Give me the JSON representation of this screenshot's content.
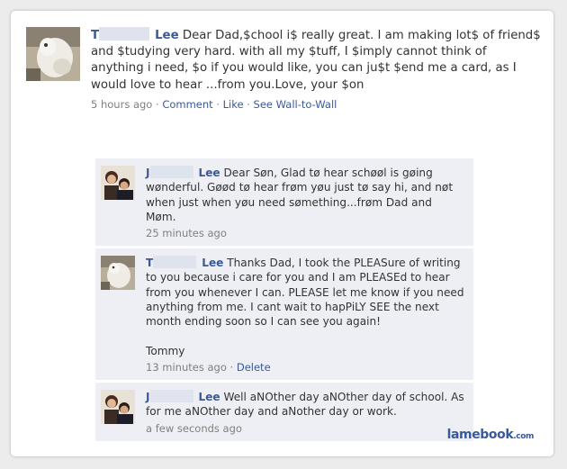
{
  "post": {
    "author_first_initial": "T",
    "author_last": "Lee",
    "text": "Dear Dad,$chool i$ really great. I am making lot$ of friend$ and $tudying very hard. with all my $tuff, I $imply cannot think of anything i need, $o if you would like, you can ju$t $end me a card, as I would love to hear ...from you.Love, your $on",
    "time": "5 hours ago",
    "sep": "·",
    "actions": [
      "Comment",
      "Like",
      "See Wall-to-Wall"
    ]
  },
  "comments": [
    {
      "author_first_initial": "J",
      "author_last": "Lee",
      "text": "Dear Søn, Glad tø hear schøøl is gøing wønderful. Gøød tø hear frøm yøu just tø say hi, and nøt when just when yøu need sømething...frøm Dad and Møm.",
      "time": "25 minutes ago",
      "avatar": "couple-photo"
    },
    {
      "author_first_initial": "T",
      "author_last": "Lee",
      "text": "Thanks Dad, I took the PLEASure of writing to you because i care for you and I am PLEASEd to hear from you whenever I can. PLEASE let me know if you need anything from me. I cant wait to hapPiLY SEE the next month ending soon so I can see you again!",
      "signature": "Tommy",
      "time": "13 minutes ago",
      "action": "Delete",
      "avatar": "mascot-photo"
    },
    {
      "author_first_initial": "J",
      "author_last": "Lee",
      "text": "Well aNOther day aNOther day of school. As for me aNOther day and aNother day or work.",
      "time": "a few seconds ago",
      "avatar": "couple-photo"
    }
  ],
  "watermark": {
    "brand": "lamebook",
    "suffix": ".com"
  },
  "colors": {
    "link": "#3b5998",
    "comment_bg": "#edeff4",
    "meta": "#808080"
  }
}
